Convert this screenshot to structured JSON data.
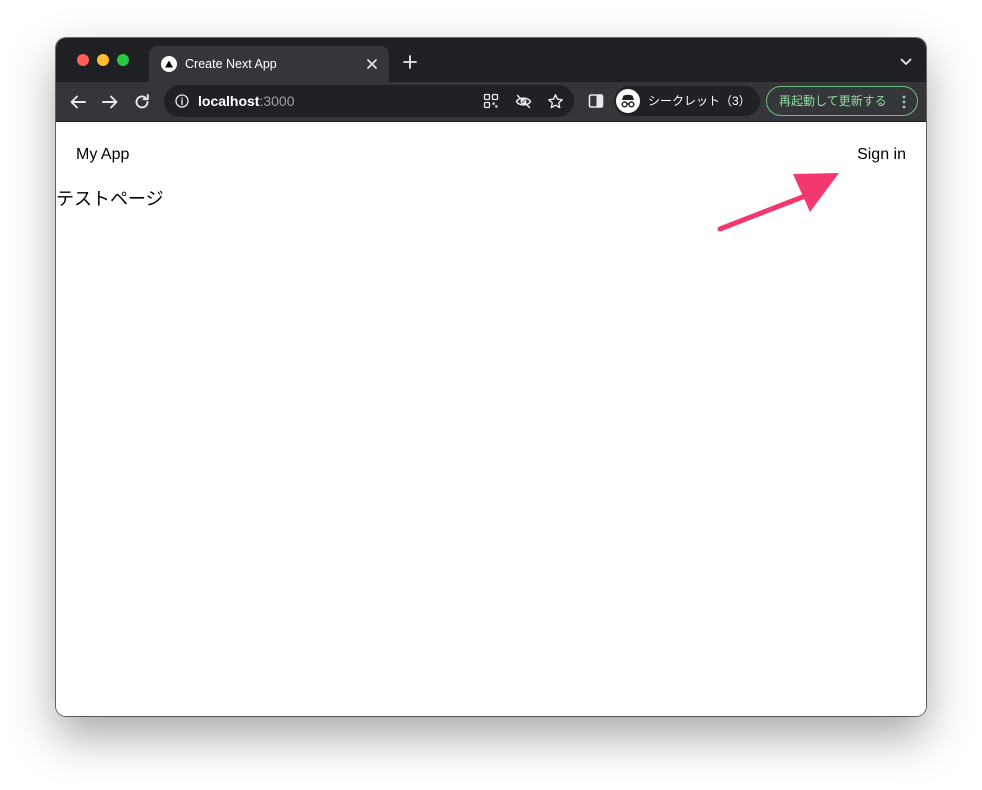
{
  "browser": {
    "tab": {
      "title": "Create Next App"
    },
    "address_bar": {
      "host": "localhost",
      "port": ":3000"
    },
    "incognito": {
      "label": "シークレット（3）"
    },
    "relaunch": {
      "label": "再起動して更新する"
    },
    "icons": {
      "favicon": "nextjs-triangle-icon",
      "close": "close-icon",
      "new_tab": "plus-icon",
      "tab_search": "chevron-down-icon",
      "back": "arrow-left-icon",
      "forward": "arrow-right-icon",
      "reload": "reload-icon",
      "site_info": "info-icon",
      "install": "qr-code-icon",
      "tracking": "eye-off-icon",
      "bookmark": "star-icon",
      "side_panel": "side-panel-icon",
      "incognito": "incognito-icon",
      "menu": "more-vertical-icon"
    },
    "colors": {
      "tab_bar": "#1f2023",
      "toolbar": "#35363a",
      "relaunch_accent": "#8fdca0"
    }
  },
  "page": {
    "nav": {
      "brand": "My App",
      "signin": "Sign in"
    },
    "heading": "テストページ"
  },
  "annotation": {
    "arrow_color": "#f2386f"
  }
}
